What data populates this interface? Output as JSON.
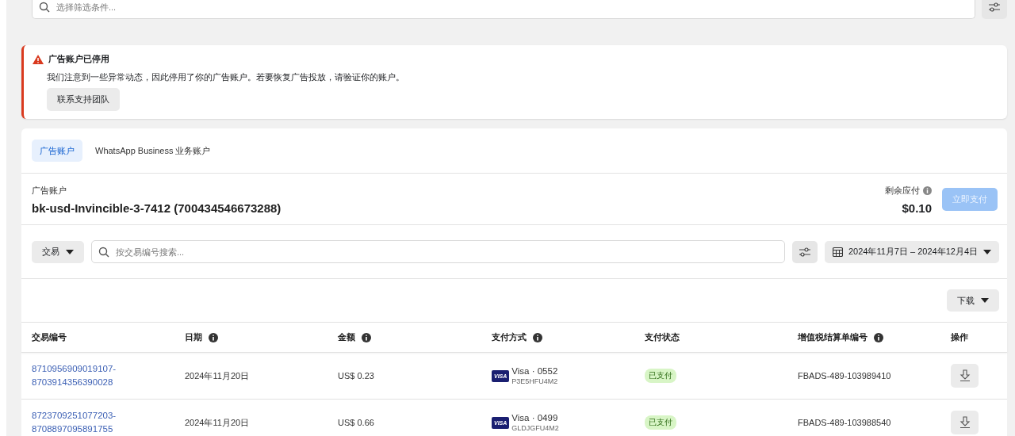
{
  "filter_search": {
    "placeholder": "选择筛选条件..."
  },
  "alert": {
    "title": "广告账户已停用",
    "message": "我们注意到一些异常动态，因此停用了你的广告账户。若要恢复广告投放，请验证你的账户。",
    "button": "联系支持团队"
  },
  "tabs": [
    {
      "label": "广告账户",
      "selected": true
    },
    {
      "label": "WhatsApp Business 业务账户",
      "selected": false
    }
  ],
  "account": {
    "label": "广告账户",
    "name": "bk-usd-Invincible-3-7412 (700434546673288)",
    "balance_label": "剩余应付",
    "balance": "$0.10",
    "pay_button": {
      "label": "立即支付",
      "disabled": true
    }
  },
  "toolbar": {
    "type_dropdown": "交易",
    "search": {
      "placeholder": "按交易编号搜索..."
    },
    "date_range": "2024年11月7日 – 2024年12月4日"
  },
  "download_button": "下载",
  "table": {
    "columns": [
      {
        "label": "交易编号",
        "kind": "plain"
      },
      {
        "label": "日期",
        "kind": "info"
      },
      {
        "label": "金额",
        "kind": "info"
      },
      {
        "label": "支付方式",
        "kind": "info"
      },
      {
        "label": "支付状态",
        "kind": "plain"
      },
      {
        "label": "增值税结算单编号",
        "kind": "info"
      },
      {
        "label": "操作",
        "kind": "plain"
      }
    ],
    "rows": [
      {
        "transaction_id": "8710956909019107-8703914356390028",
        "date": "2024年11月20日",
        "amount": "US$ 0.23",
        "card_logo": "VISA",
        "payment_method": "Visa · 0552",
        "payment_ref": "P3E5HFU4M2",
        "status": "已支付",
        "vat_invoice": "FBADS-489-103989410"
      },
      {
        "transaction_id": "8723709251077203-8708897095891755",
        "date": "2024年11月20日",
        "amount": "US$ 0.66",
        "card_logo": "VISA",
        "payment_method": "Visa · 0499",
        "payment_ref": "GLDJGFU4M2",
        "status": "已支付",
        "vat_invoice": "FBADS-489-103988540"
      }
    ]
  }
}
